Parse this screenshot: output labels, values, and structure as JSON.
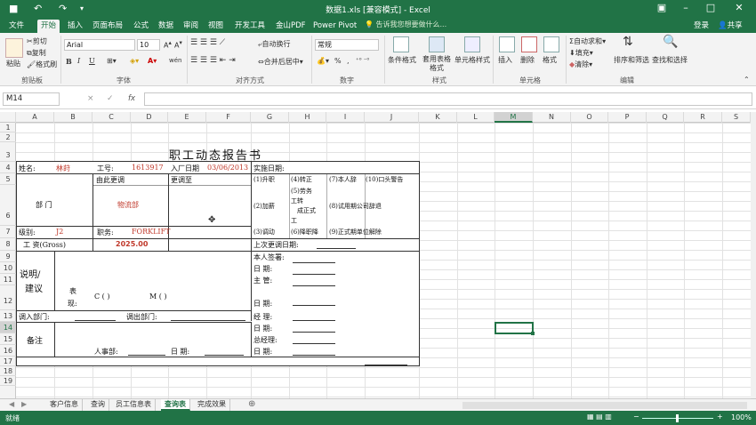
{
  "titlebar": {
    "save_icon": "save-icon",
    "undo_icon": "undo-icon",
    "redo_icon": "redo-icon",
    "title": "数据1.xls [兼容模式] - Excel",
    "login": "登录",
    "share": "共享"
  },
  "tabs": [
    "文件",
    "开始",
    "插入",
    "页面布局",
    "公式",
    "数据",
    "审阅",
    "视图",
    "开发工具",
    "金山PDF",
    "Power Pivot"
  ],
  "tellme": "告诉我您想要做什么...",
  "ribbon": {
    "clipboard": {
      "paste": "粘贴",
      "cut": "剪切",
      "copy": "复制",
      "format_painter": "格式刷",
      "label": "剪贴板"
    },
    "font": {
      "name": "Arial",
      "size": "10",
      "bold": "B",
      "italic": "I",
      "underline": "U",
      "label": "字体",
      "wen": "wén"
    },
    "alignment": {
      "wrap": "自动换行",
      "merge": "合并后居中",
      "label": "对齐方式"
    },
    "number": {
      "format": "常规",
      "percent": "%",
      "comma": ",",
      "label": "数字"
    },
    "styles": {
      "conditional": "条件格式",
      "table": "套用表格格式",
      "cell": "单元格样式",
      "label": "样式"
    },
    "cells": {
      "insert": "插入",
      "delete": "删除",
      "format": "格式",
      "label": "单元格"
    },
    "editing": {
      "autosum": "自动求和",
      "fill": "填充",
      "clear": "清除",
      "sort": "排序和筛选",
      "find": "查找和选择",
      "label": "编辑"
    }
  },
  "formula_bar": {
    "name_box": "M14",
    "fx": "fx",
    "cancel": "×",
    "enter": "✓",
    "value": ""
  },
  "columns": [
    "A",
    "B",
    "C",
    "D",
    "E",
    "F",
    "G",
    "H",
    "I",
    "J",
    "K",
    "L",
    "M",
    "N",
    "O",
    "P",
    "Q",
    "R",
    "S"
  ],
  "rows": [
    "1",
    "2",
    "3",
    "4",
    "5",
    "6",
    "7",
    "8",
    "9",
    "10",
    "11",
    "12",
    "13",
    "14",
    "15",
    "16",
    "17",
    "18",
    "19"
  ],
  "selected": {
    "column": "M",
    "row": "14"
  },
  "sheet": {
    "title": "职工动态报告书",
    "name_label": "姓名:",
    "name": "林莳",
    "id_label": "工号:",
    "id": "1613917",
    "date_label": "入厂日期",
    "date": "03/06/2013",
    "impl_label": "实施日期:",
    "from_label": "由此更调",
    "to_label": "更调至",
    "opt1": "(1)升职",
    "opt4": "(4)转正",
    "opt7": "(7)本人辞",
    "opt10": "(10)口头警告",
    "opt5a": "(5)劳务",
    "opt5b": "工转",
    "opt5c": "成正式",
    "opt5d": "工",
    "dept_label": "部  门",
    "dept": "物流部",
    "opt2": "(2)加薪",
    "opt8": "(8)试用期公司辞退",
    "grade_label": "级别:",
    "grade": "J2",
    "title_label": "职务:",
    "job_title": "FORKLIFT",
    "opt3": "(3)调动",
    "opt6": "(6)降职降",
    "opt9": "(9)正式期单位解除",
    "salary_label": "工  资(Gross)",
    "salary": "2025.00",
    "last_date_label": "上次更调日期:",
    "explain_label": "说明/",
    "suggest_label": "建议",
    "sign_label": "本人签署:",
    "date1_label": "日  期:",
    "mgr_label": "主  管:",
    "perf_label1": "表",
    "perf_label2": "现:",
    "perf_c": "C (    )",
    "perf_m": "M (    )",
    "date2_label": "日  期:",
    "in_dept_label": "调入部门:",
    "out_dept_label": "调出部门:",
    "manager_label": "经  理:",
    "remark_label": "备注",
    "date3_label": "日  期:",
    "gm_label": "总经理:",
    "hr_label": "人事部:",
    "date4_label": "日  期:",
    "date5_label": "日  期:"
  },
  "sheet_tabs": [
    "客户信息",
    "查询",
    "员工信息表",
    "查询表",
    "完成效果"
  ],
  "active_sheet_tab": "查询表",
  "status": {
    "ready": "就绪",
    "zoom": "100%"
  }
}
